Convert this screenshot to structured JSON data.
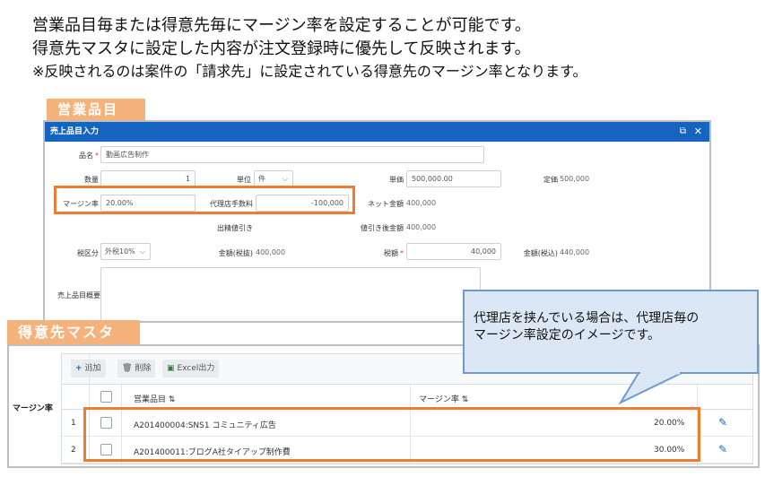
{
  "intro": {
    "line1": "営業品目毎または得意先毎にマージン率を設定することが可能です。",
    "line2": "得意先マスタに設定した内容が注文登録時に優先して反映されます。",
    "line3": "※反映されるのは案件の「請求先」に設定されている得意先のマージン率となります。"
  },
  "tags": {
    "sales_item": "営業品目",
    "client_master": "得意先マスタ"
  },
  "dialog": {
    "title": "売上品目入力",
    "fields": {
      "item_name_label": "品名",
      "item_name_value": "動画広告制作",
      "quantity_label": "数量",
      "quantity_value": "1",
      "unit_label": "単位",
      "unit_value": "件",
      "unit_price_label": "単価",
      "unit_price_value": "500,000.00",
      "list_price_label": "定価",
      "list_price_value": "500,000",
      "margin_label": "マージン率",
      "margin_value": "20.00%",
      "agency_fee_label": "代理店手数料",
      "agency_fee_value": "-100,000",
      "net_amount_label": "ネット金額",
      "net_amount_value": "400,000",
      "shipping_discount_label": "出精値引き",
      "after_discount_label": "値引き後金額",
      "after_discount_value": "400,000",
      "tax_type_label": "税区分",
      "tax_type_value": "外税10%",
      "amount_excl_label": "金額(税抜)",
      "amount_excl_value": "400,000",
      "tax_label": "税額",
      "tax_value": "40,000",
      "amount_incl_label": "金額(税込)",
      "amount_incl_value": "440,000",
      "summary_label": "売上品目概要"
    }
  },
  "client_panel": {
    "row_label": "マージン率",
    "toolbar": {
      "add": "追加",
      "delete": "削除",
      "excel": "Excel出力"
    },
    "columns": {
      "item": "営業品目",
      "margin": "マージン率"
    },
    "rows": [
      {
        "no": "1",
        "item": "A201400004:SNS1 コミュニティ広告",
        "margin": "20.00%"
      },
      {
        "no": "2",
        "item": "A201400011:ブログA社タイアップ制作費",
        "margin": "30.00%"
      }
    ]
  },
  "callout": {
    "line1": "代理店を挟んでいる場合は、代理店毎の",
    "line2": "マージン率設定のイメージです。"
  },
  "colors": {
    "accent_blue": "#1565c0",
    "highlight_orange": "#ed7d31",
    "tag_orange": "#f5b27a",
    "callout_fill": "#dbe7f4",
    "callout_border": "#6d9bd0"
  }
}
